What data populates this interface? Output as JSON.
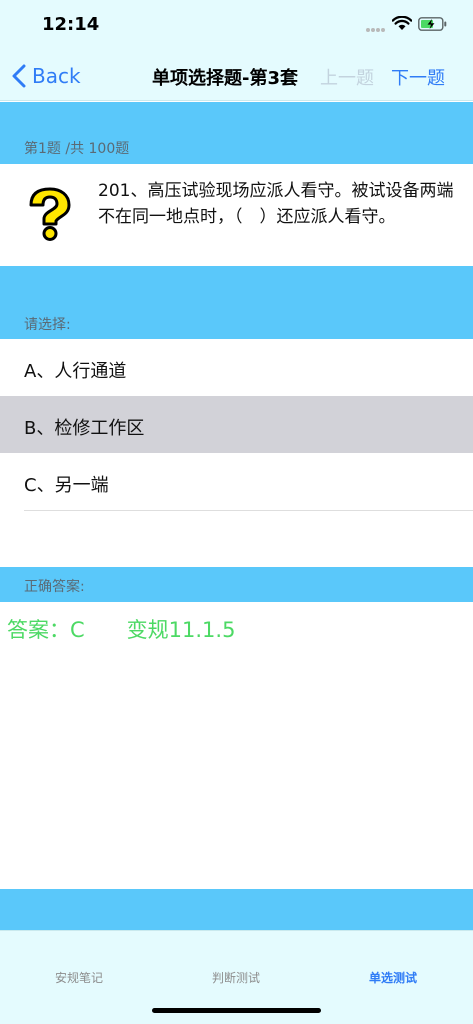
{
  "status": {
    "time": "12:14"
  },
  "nav": {
    "back_label": "Back",
    "title": "单项选择题-第3套",
    "prev_label": "上一题",
    "next_label": "下一题"
  },
  "question": {
    "counter": "第1题 /共 100题",
    "text": "201、高压试验现场应派人看守。被试设备两端不在同一地点时，（　）还应派人看守。"
  },
  "choices": {
    "header": "请选择:",
    "options": [
      {
        "label": "A、人行通道",
        "selected": false
      },
      {
        "label": "B、检修工作区",
        "selected": true
      },
      {
        "label": "C、另一端",
        "selected": false
      }
    ]
  },
  "answer": {
    "header": "正确答案:",
    "text": "答案：C　　变规11.1.5"
  },
  "tabs": [
    {
      "label": "安规笔记",
      "active": false
    },
    {
      "label": "判断测试",
      "active": false
    },
    {
      "label": "单选测试",
      "active": true
    }
  ],
  "colors": {
    "accent": "#2f7cf6",
    "section_band": "#5ac8fa",
    "answer_green": "#4cd964",
    "selected_row": "#d2d2d8"
  }
}
